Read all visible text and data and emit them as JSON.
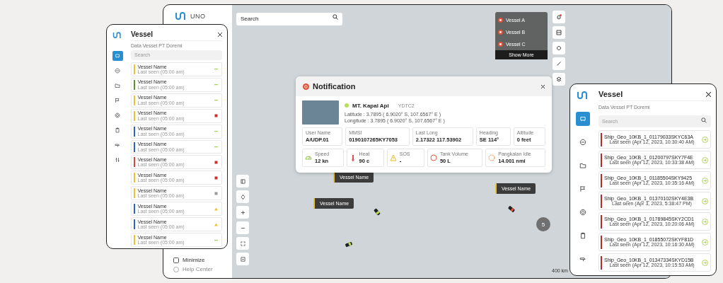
{
  "dashboard": {
    "logo": "UNO",
    "search": {
      "placeholder": "Search"
    },
    "alerts": [
      {
        "title": "Vessel A"
      },
      {
        "title": "Vessel B"
      },
      {
        "title": "Vessel C"
      }
    ],
    "show_more": "Show More",
    "vessel_tags": [
      {
        "label": "Vessel Name"
      },
      {
        "label": "Vessel Name"
      },
      {
        "label": "Vessel Name"
      }
    ],
    "cluster": "5",
    "scale": "400 km",
    "sidebar_links": [
      {
        "label": "Minimize"
      },
      {
        "label": "Help Center"
      }
    ]
  },
  "vessel_panel_small": {
    "title": "Vessel",
    "subtitle": "Data Vessel PT Doremi",
    "search": {
      "placeholder": "Search"
    },
    "nav": [
      {
        "selected": true
      },
      {
        "selected": false
      },
      {
        "selected": false
      },
      {
        "selected": false
      },
      {
        "selected": false
      },
      {
        "selected": false
      },
      {
        "selected": false
      },
      {
        "selected": false
      }
    ],
    "items": [
      {
        "name": "Vessel Name",
        "seen": "Last seen (05:00 am)",
        "color": "#f2c12e",
        "status": {
          "kind": "dash",
          "color": "#a6d34a"
        }
      },
      {
        "name": "Vessel Name",
        "seen": "Last seen (05:00 am)",
        "color": "#5f8f2e",
        "status": {
          "kind": "dash",
          "color": "#a6d34a"
        }
      },
      {
        "name": "Vessel Name",
        "seen": "Last seen (05:00 am)",
        "color": "#f2c12e",
        "status": {
          "kind": "dash",
          "color": "#a6d34a"
        }
      },
      {
        "name": "Vessel Name",
        "seen": "Last seen (05:00 am)",
        "color": "#f2c12e",
        "status": {
          "kind": "square",
          "color": "#c8322c"
        }
      },
      {
        "name": "Vessel Name",
        "seen": "Last seen (05:00 am)",
        "color": "#2f5fd0",
        "status": {
          "kind": "dash",
          "color": "#a6d34a"
        }
      },
      {
        "name": "Vessel Name",
        "seen": "Last seen (05:00 am)",
        "color": "#2f5fd0",
        "status": {
          "kind": "dash",
          "color": "#a6d34a"
        }
      },
      {
        "name": "Vessel Name",
        "seen": "Last seen (05:00 am)",
        "color": "#d9453f",
        "status": {
          "kind": "square",
          "color": "#c8322c"
        }
      },
      {
        "name": "Vessel Name",
        "seen": "Last seen (05:00 am)",
        "color": "#f2c12e",
        "status": {
          "kind": "square",
          "color": "#c8322c"
        }
      },
      {
        "name": "Vessel Name",
        "seen": "Last seen (05:00 am)",
        "color": "#f2c12e",
        "status": {
          "kind": "square",
          "color": "#9a9a9a"
        }
      },
      {
        "name": "Vessel Name",
        "seen": "Last seen (05:00 am)",
        "color": "#2f5fd0",
        "status": {
          "kind": "triangle",
          "color": "#f2c12e"
        }
      },
      {
        "name": "Vessel Name",
        "seen": "Last seen (05:00 am)",
        "color": "#2f5fd0",
        "status": {
          "kind": "triangle",
          "color": "#f2c12e"
        }
      },
      {
        "name": "Vessel Name",
        "seen": "Last seen (05:00 am)",
        "color": "#f2c12e",
        "status": {
          "kind": "dash",
          "color": "#a6d34a"
        }
      }
    ]
  },
  "notification": {
    "title": "Notification",
    "vessel": "MT. Kapal Api",
    "code": "YDTC2",
    "coords": [
      {
        "label": "Latitude",
        "value": ": 3.7895 ( 6.9020° S, 107.6567° E )"
      },
      {
        "label": "Longitude",
        "value": ": 3.7895 ( 6.9020° S, 107.6567° E )"
      }
    ],
    "fields": [
      {
        "label": "User Name",
        "value": "A/UDP.01"
      },
      {
        "label": "MMSI",
        "value": "0190107265KY7053"
      },
      {
        "label": "Last Long",
        "value": "2.17322 117.53902"
      },
      {
        "label": "Heading",
        "value": "SE 114°"
      },
      {
        "label": "Altitude",
        "value": "0 feet"
      }
    ],
    "tiles": [
      {
        "kind": "speed",
        "label": "Speed",
        "value": "12 kn"
      },
      {
        "kind": "heat",
        "label": "Heat",
        "value": "90 c"
      },
      {
        "kind": "sos",
        "label": "SOS",
        "value": "-"
      },
      {
        "kind": "tank",
        "label": "Tank Volume",
        "value": "50 L"
      },
      {
        "kind": "idle",
        "label": "Pangkalan Idle",
        "value": "14.001 nmi"
      }
    ]
  },
  "vessel_panel_large": {
    "title": "Vessel",
    "subtitle": "Data Vessel PT Doremi",
    "search": {
      "placeholder": "Search"
    },
    "nav": [
      {
        "selected": true
      },
      {
        "selected": false
      },
      {
        "selected": false
      },
      {
        "selected": false
      },
      {
        "selected": false
      },
      {
        "selected": false
      },
      {
        "selected": false
      }
    ],
    "items": [
      {
        "name": "Ship_Geo_10KB_1_01179033SKYC63A",
        "seen": "Last seen (Apr 12, 2023, 10:30:40 AM)"
      },
      {
        "name": "Ship_Geo_10KB_1_01200797SKY7F4E",
        "seen": "Last seen (Apr 12, 2023, 10:33:38 AM)"
      },
      {
        "name": "Ship_Geo_10KB_1_01185504SKY9425",
        "seen": "Last seen (Apr 12, 2023, 10:35:16 AM)"
      },
      {
        "name": "Ship_Geo_10KB_1_01370102SKY4E3B",
        "seen": "Last seen (Apr 3, 2023, 5:38:47 PM)"
      },
      {
        "name": "Ship_Geo_10KB_1_01789845SKY2CD1",
        "seen": "Last seen (Apr 12, 2023, 10:20:06 AM)"
      },
      {
        "name": "Ship_Geo_10KB_1_01855072SKYF81D",
        "seen": "Last seen (Apr 12, 2023, 10:16:30 AM)"
      },
      {
        "name": "Ship_Geo_10KB_1_01347334SKYD15B",
        "seen": "Last seen (Apr 12, 2023, 10:15:53 AM)"
      }
    ]
  }
}
